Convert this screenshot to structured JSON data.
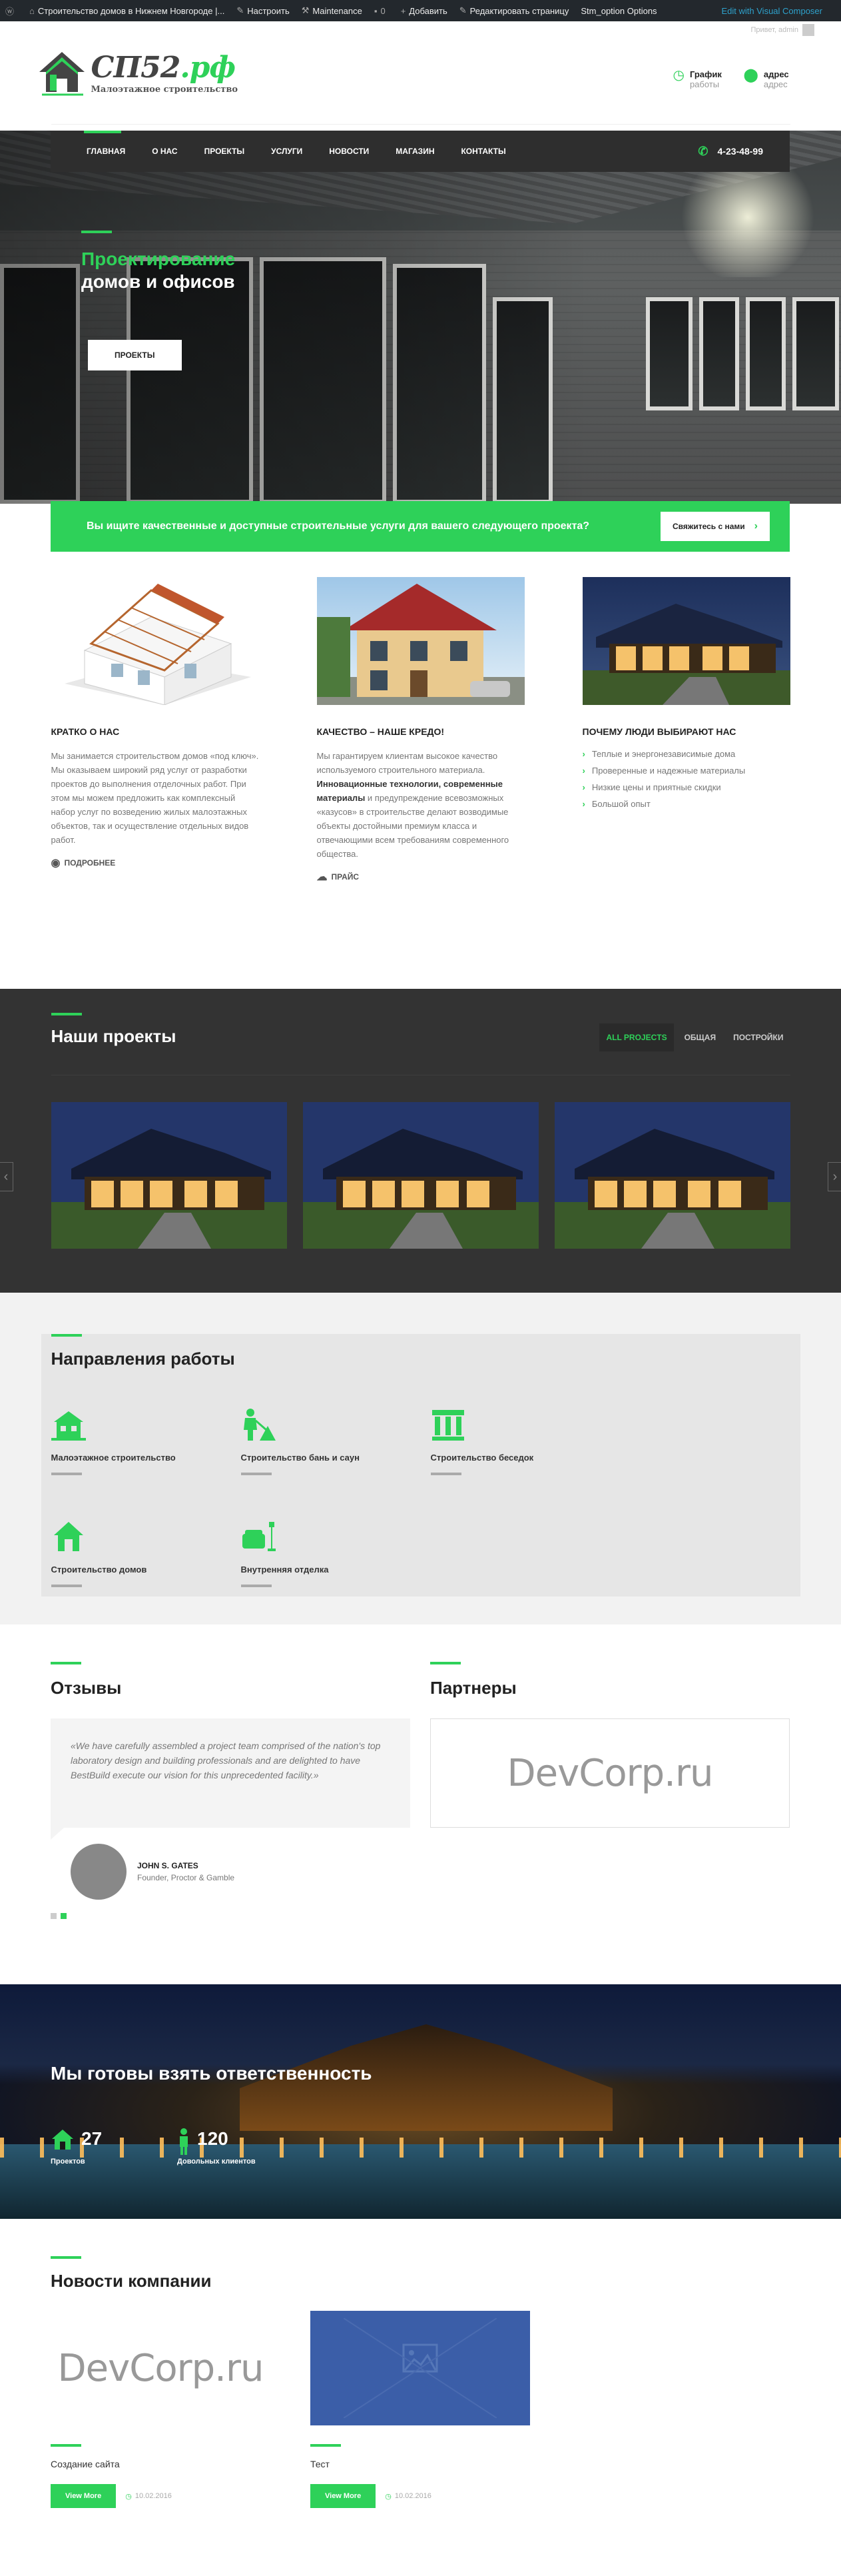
{
  "admin_bar": {
    "site_title": "Строительство домов в Нижнем Новгороде |...",
    "customize": "Настроить",
    "maintenance": "Maintenance",
    "add": "Добавить",
    "edit_page": "Редактировать страницу",
    "stm_options": "Stm_option Options",
    "visual_composer": "Edit with Visual Composer"
  },
  "header": {
    "greeting": "Привет, admin",
    "logo_main": "СП52",
    "logo_suffix": ".рф",
    "logo_tagline": "Малоэтажное строительство",
    "schedule_title": "График",
    "schedule_sub": "работы",
    "address_title": "адрес",
    "address_sub": "адрес"
  },
  "nav": {
    "items": [
      "Главная",
      "О нас",
      "Проекты",
      "Услуги",
      "Новости",
      "Магазин",
      "Контакты"
    ],
    "phone": "4-23-48-99"
  },
  "hero": {
    "title_green": "Проектирование",
    "title_white": "домов и офисов",
    "button": "Проекты"
  },
  "cta": {
    "text": "Вы ищите качественные и доступные строительные услуги для вашего следующего проекта?",
    "button": "Свяжитесь с нами"
  },
  "about": {
    "col1": {
      "title": "Кратко о нас",
      "text": "Мы занимается строительством домов «под ключ». Мы оказываем широкий ряд услуг от разработки проектов до выполнения отделочных работ. При этом мы можем предложить как комплексный набор услуг по возведению жилых малоэтажных объектов, так и осуществление отдельных видов работ.",
      "link": "Подробнее"
    },
    "col2": {
      "title": "Качество – наше кредо!",
      "text_a": "Мы гарантируем клиентам высокое качество используемого строительного материала.",
      "text_bold": "Инновационные технологии, современные материалы",
      "text_b": "и предупреждение всевозможных «казусов» в строительстве делают возводимые объекты достойными премиум класса и отвечающими всем требованиям современного общества.",
      "link": "Прайс"
    },
    "col3": {
      "title": "Почему люди выбирают нас",
      "items": [
        "Теплые и энергонезависимые дома",
        "Проверенные и надежные материалы",
        "Низкие цены и приятные скидки",
        "Большой опыт"
      ]
    }
  },
  "projects": {
    "title": "Наши проекты",
    "filters": [
      "All projects",
      "Общая",
      "Постройки"
    ]
  },
  "directions": {
    "title": "Направления работы",
    "items": [
      "Малоэтажное строительство",
      "Строительство бань и саун",
      "Строительство беседок",
      "Строительство домов",
      "Внутренняя отделка"
    ]
  },
  "testimonials": {
    "title": "Отзывы",
    "quote": "«We have carefully assembled a project team comprised of the nation's top laboratory design and building professionals and are delighted to have BestBuild execute our vision for this unprecedented facility.»",
    "author_name": "John S. Gates",
    "author_role": "Founder, Proctor & Gamble"
  },
  "partners": {
    "title": "Партнеры",
    "logo_text": "DevCorp.ru"
  },
  "stats": {
    "title": "Мы готовы взять ответственность",
    "items": [
      {
        "num": "27",
        "label": "Проектов"
      },
      {
        "num": "120",
        "label": "Довольных клиентов"
      }
    ]
  },
  "news": {
    "title": "Новости компании",
    "cards": [
      {
        "logo_text": "DevCorp.ru",
        "title": "Создание сайта",
        "button": "View More",
        "date": "10.02.2016"
      },
      {
        "title": "Тест",
        "button": "View More",
        "date": "10.02.2016"
      }
    ]
  },
  "colors": {
    "accent": "#2ed159",
    "dark": "#2e2e2e"
  }
}
